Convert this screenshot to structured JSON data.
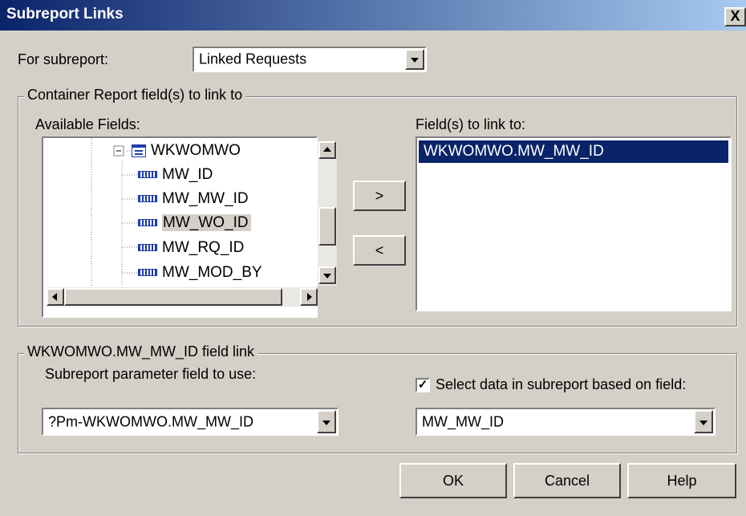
{
  "window": {
    "title": "Subreport Links",
    "close_label": "X"
  },
  "subreport": {
    "label": "For subreport:",
    "selected": "Linked Requests"
  },
  "container_group": {
    "legend": "Container Report field(s) to link to",
    "available_label": "Available Fields:",
    "tree": {
      "parent": "WKWOMWO",
      "parent_icon": "table-icon",
      "children": [
        "MW_ID",
        "MW_MW_ID",
        "MW_WO_ID",
        "MW_RQ_ID",
        "MW_MOD_BY"
      ],
      "child_icon": "field-icon",
      "highlighted": "MW_WO_ID"
    },
    "add_label": ">",
    "remove_label": "<",
    "linked_label": "Field(s) to link to:",
    "linked_fields": [
      "WKWOMWO.MW_MW_ID"
    ]
  },
  "field_link_group": {
    "legend": "WKWOMWO.MW_MW_ID field link",
    "param_label": "Subreport parameter field to use:",
    "param_value": "?Pm-WKWOMWO.MW_MW_ID",
    "select_checked": true,
    "select_label": "Select data in subreport based on field:",
    "select_value": "MW_MW_ID"
  },
  "buttons": {
    "ok": "OK",
    "cancel": "Cancel",
    "help": "Help"
  },
  "colors": {
    "title_start": "#0a246a",
    "title_end": "#a6caf0",
    "face": "#d4d0c8",
    "selection": "#0a246a"
  }
}
